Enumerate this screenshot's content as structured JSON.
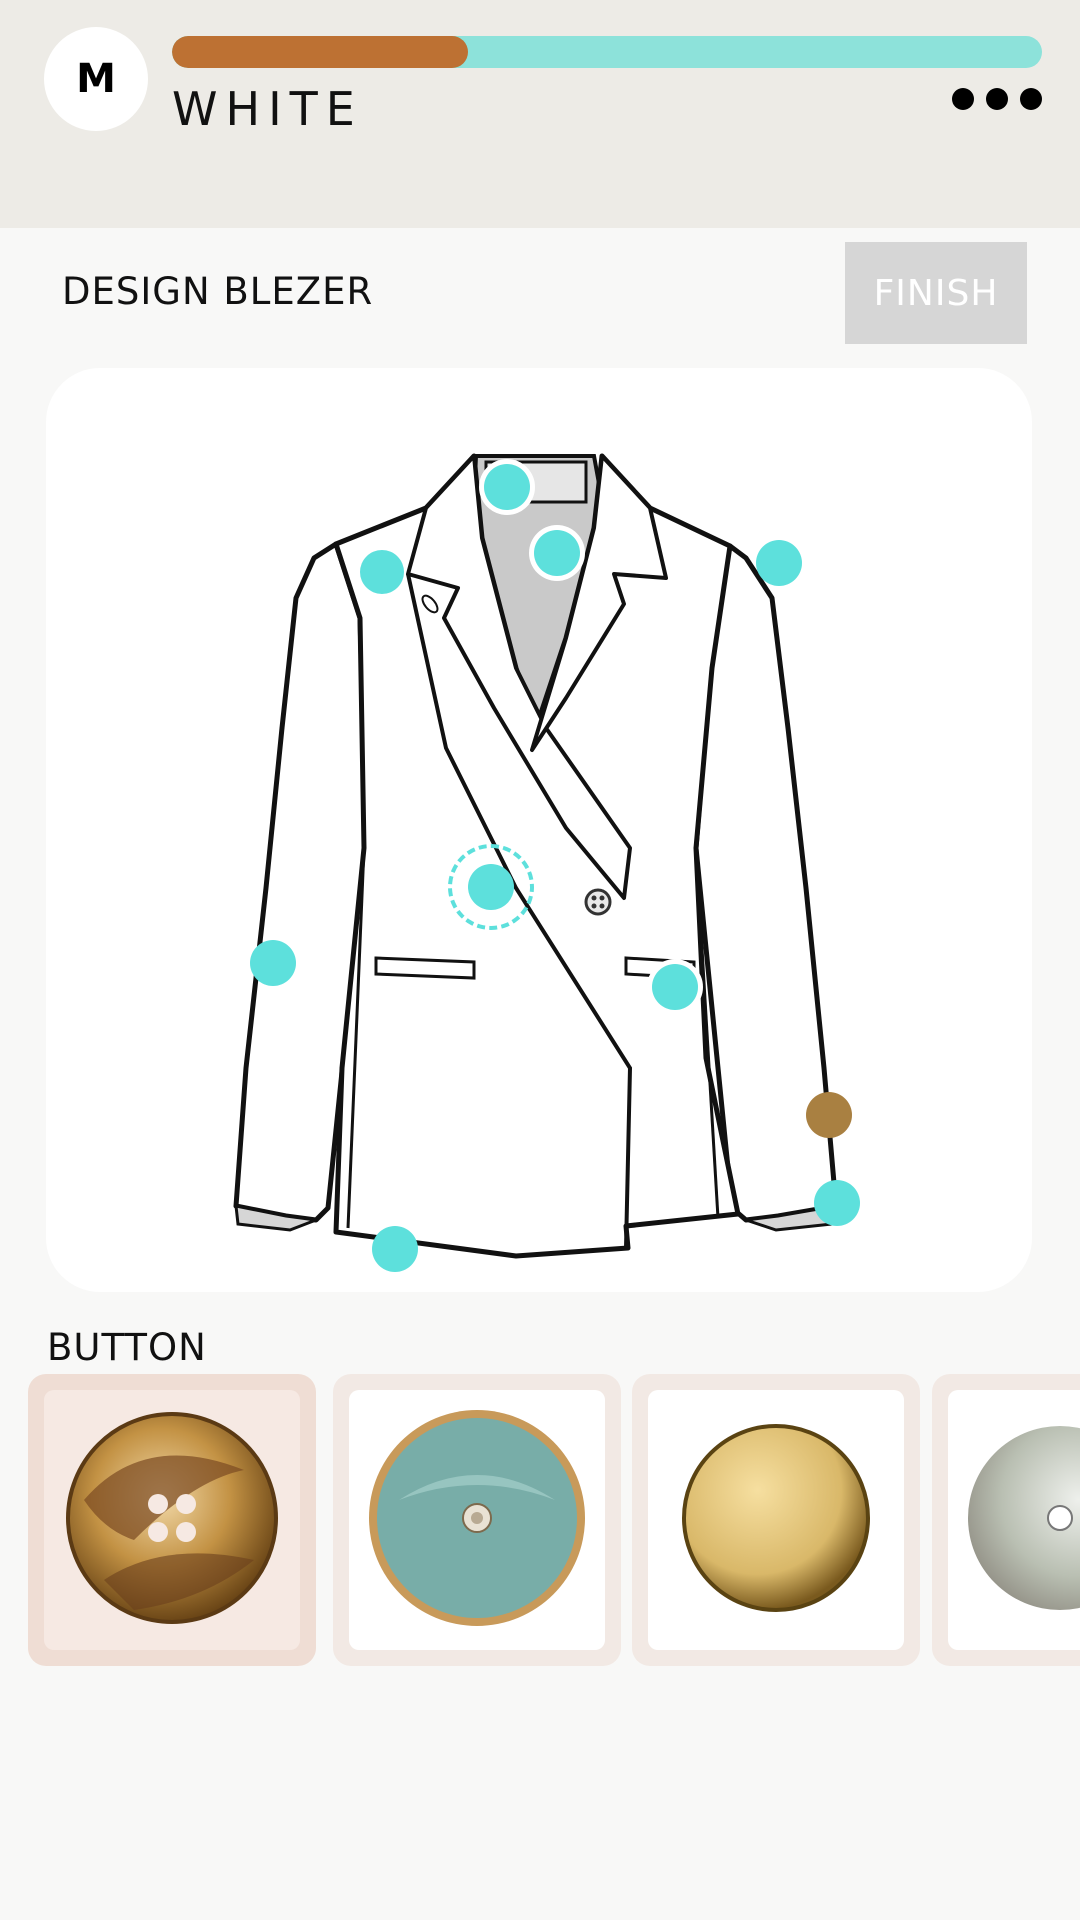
{
  "header": {
    "avatar_letter": "M",
    "color_name": "WHITE",
    "progress_fraction": 0.34,
    "more_icon": "more-dots-icon"
  },
  "design": {
    "title": "DESIGN BLEZER",
    "finish_label": "FINISH"
  },
  "colors": {
    "accent": "#5de0dc",
    "progress_done": "#bd7133",
    "progress_rest": "#8de2da",
    "hotspot_selected_alt": "#a98041"
  },
  "buttons_section": {
    "title": "BUTTON",
    "options": [
      {
        "name": "horn-four-hole-button",
        "selected": true
      },
      {
        "name": "teal-enamel-rhinestone-button",
        "selected": false
      },
      {
        "name": "gold-metal-dome-button",
        "selected": false
      },
      {
        "name": "mother-of-pearl-button",
        "selected": false
      }
    ]
  }
}
